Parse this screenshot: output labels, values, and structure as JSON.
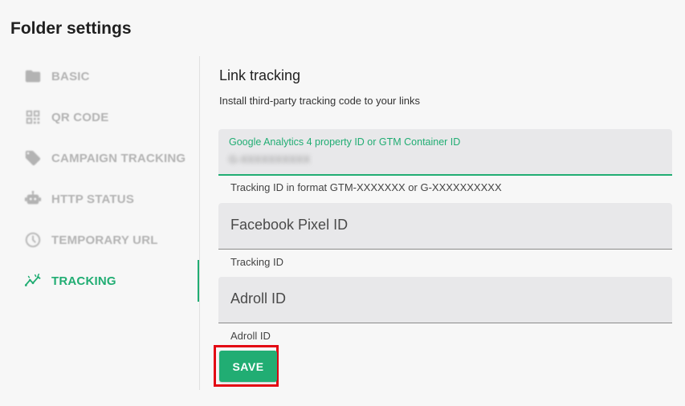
{
  "page": {
    "title": "Folder settings"
  },
  "sidebar": {
    "items": [
      {
        "label": "BASIC",
        "icon": "folder-icon",
        "active": false
      },
      {
        "label": "QR CODE",
        "icon": "qr-code-icon",
        "active": false
      },
      {
        "label": "CAMPAIGN TRACKING",
        "icon": "tag-icon",
        "active": false
      },
      {
        "label": "HTTP STATUS",
        "icon": "robot-icon",
        "active": false
      },
      {
        "label": "TEMPORARY URL",
        "icon": "clock-icon",
        "active": false
      },
      {
        "label": "TRACKING",
        "icon": "trending-line-icon",
        "active": true
      }
    ]
  },
  "tracking": {
    "title": "Link tracking",
    "description": "Install third-party tracking code to your links",
    "fields": [
      {
        "label": "Google Analytics 4 property ID or GTM Container ID",
        "value": "G-XXXXXXXXXX",
        "helper": "Tracking ID in format GTM-XXXXXXX or G-XXXXXXXXXX"
      },
      {
        "placeholder": "Facebook Pixel ID",
        "value": "",
        "helper": "Tracking ID"
      },
      {
        "placeholder": "Adroll ID",
        "value": "",
        "helper": "Adroll ID"
      }
    ],
    "save_label": "SAVE"
  },
  "colors": {
    "accent": "#21ad73",
    "highlight": "#e30613",
    "muted": "#b3b3b3"
  }
}
